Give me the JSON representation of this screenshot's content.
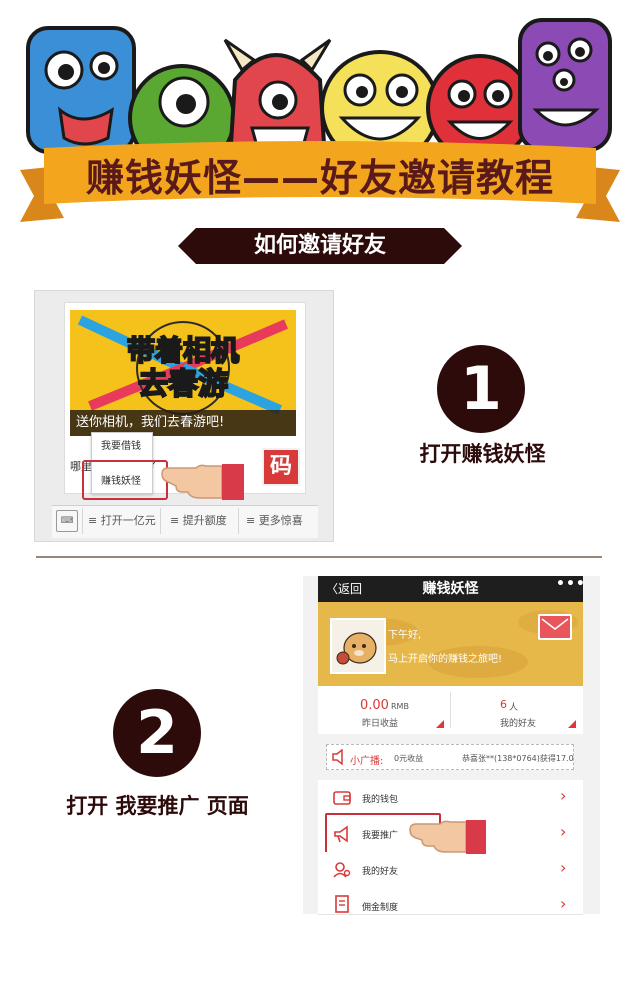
{
  "banner": {
    "title": "赚钱妖怪——好友邀请教程",
    "subtitle": "如何邀请好友"
  },
  "step1": {
    "number": "1",
    "label": "打开赚钱妖怪",
    "promo": {
      "headline_line1": "带着相机",
      "headline_line2": "去春游",
      "caption": "送你相机，我们去春游吧!"
    },
    "card_row_text": "哪里",
    "card_row_suffix": "?",
    "qr_badge": "码",
    "popup_items": [
      "我要借钱",
      "赚钱妖怪"
    ],
    "bottom_bar": {
      "keyboard_icon": "keyboard-icon",
      "items": [
        "≡ 打开一亿元",
        "≡ 提升额度",
        "≡ 更多惊喜"
      ]
    }
  },
  "step2": {
    "number": "2",
    "label": "打开 我要推广 页面",
    "app": {
      "back_label": "〈返回",
      "title": "赚钱妖怪",
      "more_label": "•••",
      "greeting_line1": "下午好,",
      "greeting_line2": "马上开启你的赚钱之旅吧!",
      "stats": [
        {
          "value": "0.00",
          "unit": "RMB",
          "label": "昨日收益"
        },
        {
          "value": "6",
          "unit": "人",
          "label": "我的好友"
        }
      ],
      "broadcast_label": "小广播:",
      "broadcast_text": "0元收益",
      "broadcast_scroll": "恭喜张**(138*0764)获得17.0",
      "menu": [
        {
          "label": "我的钱包",
          "icon": "wallet-icon"
        },
        {
          "label": "我要推广",
          "icon": "megaphone-icon"
        },
        {
          "label": "我的好友",
          "icon": "friends-icon"
        },
        {
          "label": "佣金制度",
          "icon": "document-icon"
        }
      ]
    }
  },
  "colors": {
    "dark_brown": "#2d0b0b",
    "accent_red": "#c8303a",
    "ribbon_orange": "#f0a21a",
    "promo_yellow": "#f4c21a"
  }
}
